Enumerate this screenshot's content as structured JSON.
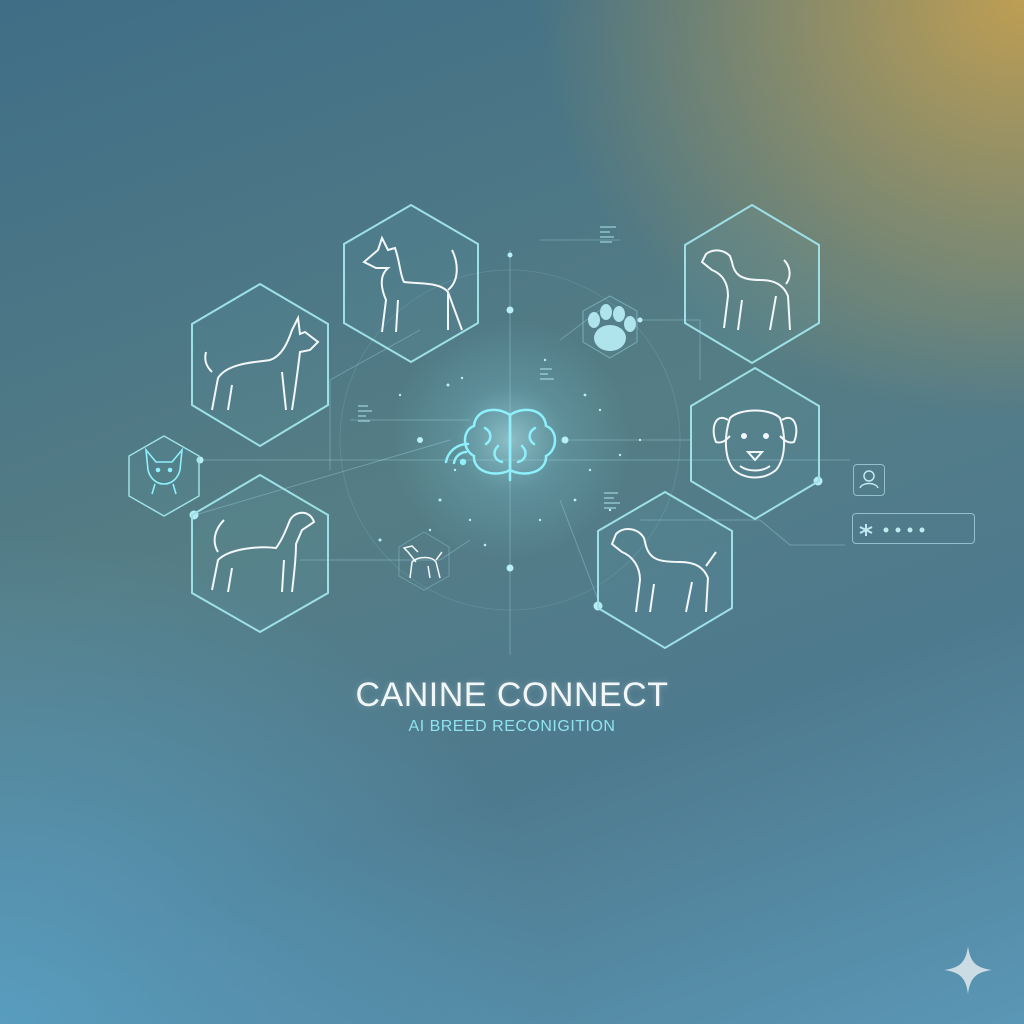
{
  "app": {
    "title": "CANINE CONNECT",
    "subtitle": "AI BREED RECONIGITION"
  },
  "icons": {
    "center": "brain-icon",
    "signal": "wifi-icon",
    "paw": "paw-icon",
    "user": "user-icon",
    "password": "password-field",
    "corner": "sparkle-icon"
  },
  "breeds": [
    "doberman-icon",
    "husky-icon",
    "chihuahua-icon",
    "pointer-icon",
    "small-dog-icon",
    "labrador-icon",
    "bulldog-icon",
    "retriever-icon"
  ],
  "colors": {
    "accent": "#8fe3ee",
    "line": "#a8dfe6",
    "title": "#f2f7f9"
  }
}
